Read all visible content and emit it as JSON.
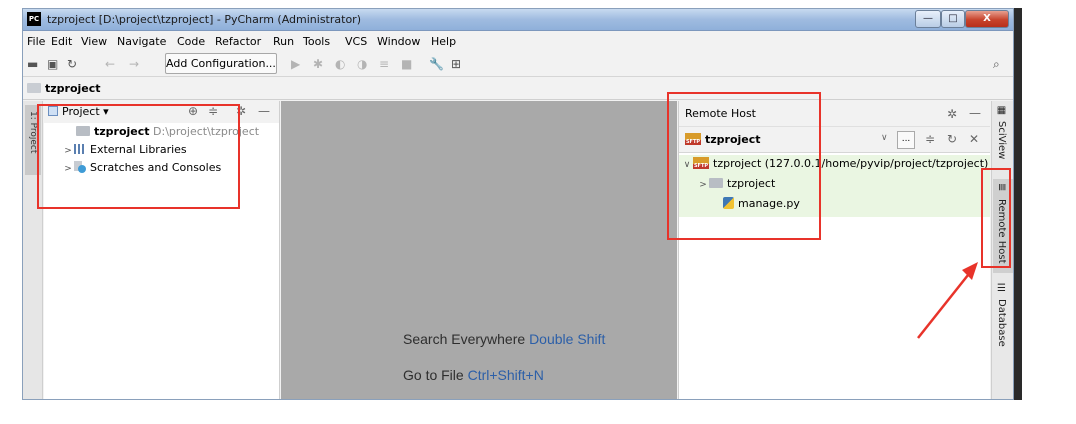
{
  "window": {
    "title": "tzproject [D:\\project\\tzproject] - PyCharm (Administrator)",
    "logo": "PC",
    "minimize_glyph": "—",
    "maximize_glyph": "□",
    "close_glyph": "X"
  },
  "menu": {
    "items": [
      "File",
      "Edit",
      "View",
      "Navigate",
      "Code",
      "Refactor",
      "Run",
      "Tools",
      "VCS",
      "Window",
      "Help"
    ]
  },
  "toolbar": {
    "add_configuration_label": "Add Configuration..."
  },
  "breadcrumb": {
    "label": "tzproject"
  },
  "left_strip": {
    "project_label": "1: Project"
  },
  "project_panel": {
    "dropdown_label": "Project",
    "dropdown_arrow": "▾",
    "tree": [
      {
        "name": "tzproject",
        "path": "D:\\project\\tzproject"
      },
      {
        "name": "External Libraries"
      },
      {
        "name": "Scratches and Consoles"
      }
    ]
  },
  "editor": {
    "hints": [
      {
        "text": "Search Everywhere",
        "key": "Double Shift"
      },
      {
        "text": "Go to File",
        "key": "Ctrl+Shift+N"
      }
    ]
  },
  "remote_host": {
    "title": "Remote Host",
    "server_name": "tzproject",
    "sftp_badge": "SFTP",
    "dropdown_button": "...",
    "tree": [
      {
        "name": "tzproject (127.0.0.1/home/pyvip/project/tzproject)"
      },
      {
        "name": "tzproject"
      },
      {
        "name": "manage.py"
      }
    ]
  },
  "right_tools": {
    "tabs": [
      "SciView",
      "Remote Host",
      "Database"
    ]
  },
  "colors": {
    "annotation_red": "#e8332a",
    "editor_bg": "#a9a9a9",
    "hint_key_blue": "#2c5fa8",
    "remote_tree_bg": "#eaf6e2"
  },
  "icons": {
    "open": "folder-open-icon",
    "save": "save-icon",
    "sync": "sync-icon",
    "back": "arrow-left-icon",
    "forward": "arrow-right-icon",
    "run": "run-icon",
    "debug": "debug-icon",
    "search": "search-icon",
    "settings": "gear-icon"
  }
}
